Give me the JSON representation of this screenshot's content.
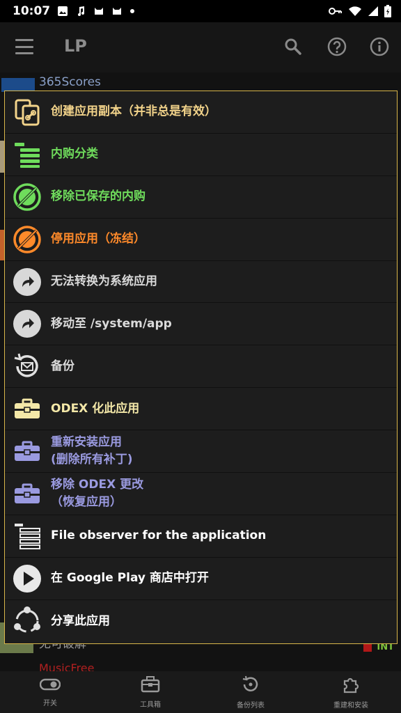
{
  "status_bar": {
    "time": "10:07",
    "left_icons": [
      "image-icon",
      "music-icon",
      "cat-icon",
      "cat-icon",
      "dot-icon"
    ],
    "right_icons": [
      "key-icon",
      "wifi-icon",
      "signal-icon",
      "battery-icon"
    ]
  },
  "app_bar": {
    "title": "LP",
    "actions": [
      "search-icon",
      "help-icon",
      "info-icon"
    ]
  },
  "background_list": {
    "first_item": "365Scores",
    "bottom_item": "无可破解",
    "bottom_badge": "INT",
    "last_item": "MusicFree"
  },
  "menu": {
    "items": [
      {
        "label": "创建应用副本（并非总是有效）",
        "icon": "copy-link-icon",
        "color": "#f2d38a"
      },
      {
        "label": "内购分类",
        "icon": "list-icon",
        "color": "#6fdc5c"
      },
      {
        "label": "移除已保存的内购",
        "icon": "remove-purchase-icon",
        "color": "#6fdc5c"
      },
      {
        "label": "停用应用（冻结）",
        "icon": "freeze-icon",
        "color": "#ff8a2a"
      },
      {
        "label": "无法转换为系统应用",
        "icon": "share-arrow-icon",
        "color": "#dadada"
      },
      {
        "label": "移动至 /system/app",
        "icon": "share-arrow-icon",
        "color": "#dadada"
      },
      {
        "label": "备份",
        "icon": "backup-icon",
        "color": "#dadada"
      },
      {
        "label": "ODEX 化此应用",
        "icon": "toolbox-icon",
        "color": "#f4e8a8"
      },
      {
        "label_line1": "重新安装应用",
        "label_line2": "(删除所有补丁)",
        "icon": "toolbox-purple-icon",
        "color": "#9a9ae0"
      },
      {
        "label_line1": "移除 ODEX 更改",
        "label_line2": "（恢复应用）",
        "icon": "toolbox-purple-icon",
        "color": "#9a9ae0"
      },
      {
        "label": "File observer for the application",
        "icon": "list-white-icon",
        "color": "#ffffff"
      },
      {
        "label": "在 Google Play 商店中打开",
        "icon": "play-icon",
        "color": "#ffffff"
      },
      {
        "label": "分享此应用",
        "icon": "share-icon",
        "color": "#ffffff"
      }
    ]
  },
  "bottom_nav": {
    "items": [
      {
        "label": "开关",
        "icon": "toggle-icon"
      },
      {
        "label": "工具箱",
        "icon": "toolbox-icon"
      },
      {
        "label": "备份列表",
        "icon": "backup-list-icon"
      },
      {
        "label": "重建和安装",
        "icon": "puzzle-icon"
      }
    ]
  },
  "colors": {
    "accent_border": "#d9b64a",
    "menu_bg": "#1d1d1d",
    "bar_bg": "#161616"
  }
}
